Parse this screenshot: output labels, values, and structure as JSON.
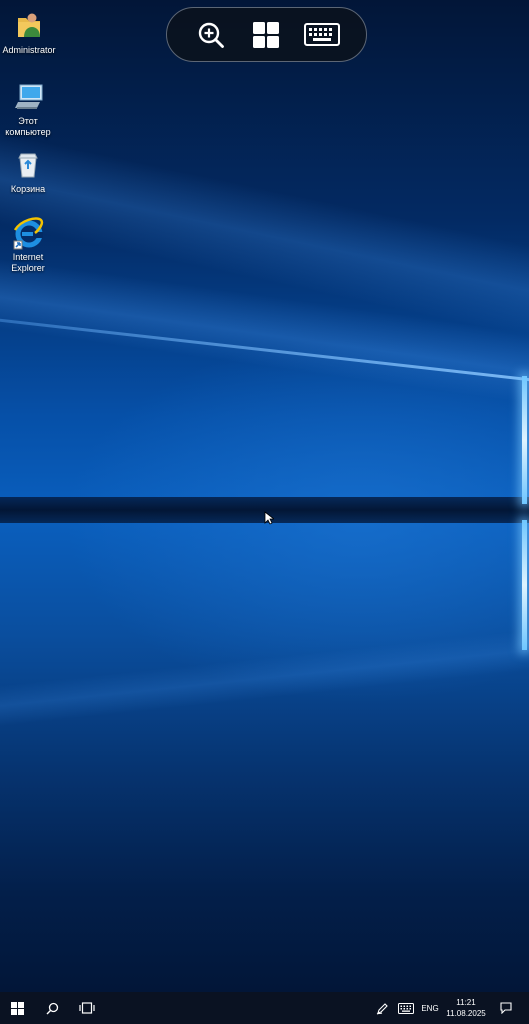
{
  "desktop": {
    "icons": [
      {
        "label": "Administrator",
        "icon": "user-folder-icon"
      },
      {
        "label": "Этот компьютер",
        "icon": "computer-icon"
      },
      {
        "label": "Корзина",
        "icon": "recycle-bin-icon"
      },
      {
        "label": "Internet Explorer",
        "icon": "internet-explorer-icon"
      }
    ]
  },
  "remote_toolbar": {
    "buttons": [
      {
        "icon": "zoom-in-icon"
      },
      {
        "icon": "windows-key-icon"
      },
      {
        "icon": "keyboard-icon"
      }
    ]
  },
  "taskbar": {
    "language": "ENG",
    "time": "11:21",
    "date": "11.08.2025",
    "icons": [
      "windows-start-icon",
      "search-icon",
      "task-view-icon",
      "pen-icon",
      "touch-keyboard-icon",
      "action-center-icon"
    ]
  },
  "colors": {
    "accent": "#0a5fbe",
    "taskbar_bg": "#0a1222",
    "toolbar_bg": "#0a121e"
  }
}
